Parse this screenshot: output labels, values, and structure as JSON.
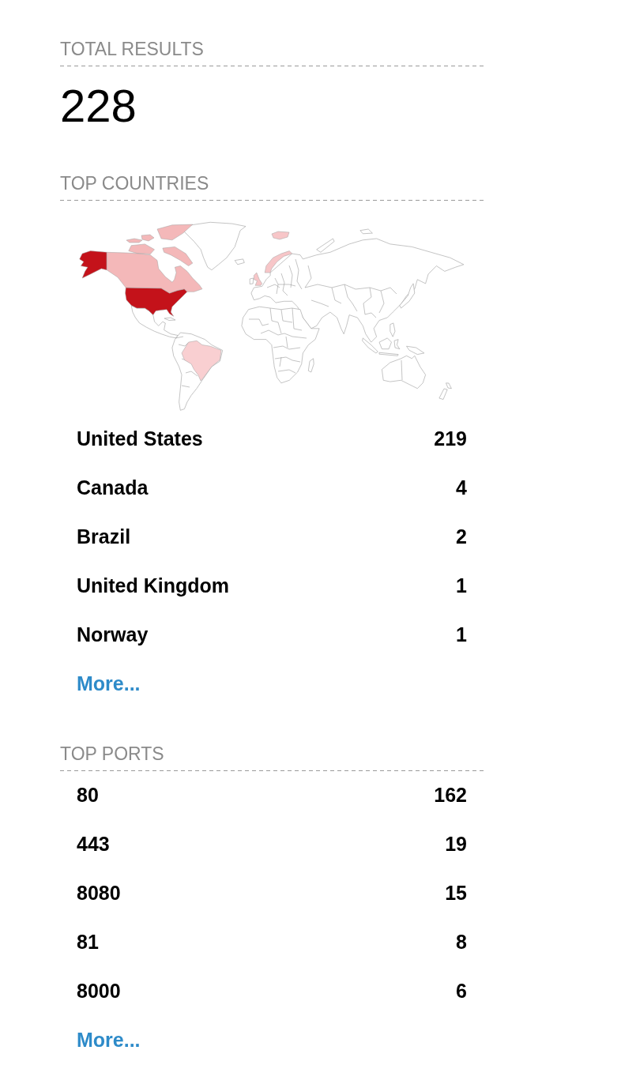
{
  "total_results": {
    "heading": "TOTAL RESULTS",
    "value": "228"
  },
  "top_countries": {
    "heading": "TOP COUNTRIES",
    "items": [
      {
        "name": "United States",
        "count": "219",
        "color": "#c4121a"
      },
      {
        "name": "Canada",
        "count": "4",
        "color": "#f4b8b9"
      },
      {
        "name": "Brazil",
        "count": "2",
        "color": "#f9cfd1"
      },
      {
        "name": "United Kingdom",
        "count": "1",
        "color": "#f7c6c8"
      },
      {
        "name": "Norway",
        "count": "1",
        "color": "#f7c6c8"
      }
    ],
    "more_link": "More..."
  },
  "top_ports": {
    "heading": "TOP PORTS",
    "items": [
      {
        "port": "80",
        "count": "162"
      },
      {
        "port": "443",
        "count": "19"
      },
      {
        "port": "8080",
        "count": "15"
      },
      {
        "port": "81",
        "count": "8"
      },
      {
        "port": "8000",
        "count": "6"
      }
    ],
    "more_link": "More..."
  }
}
